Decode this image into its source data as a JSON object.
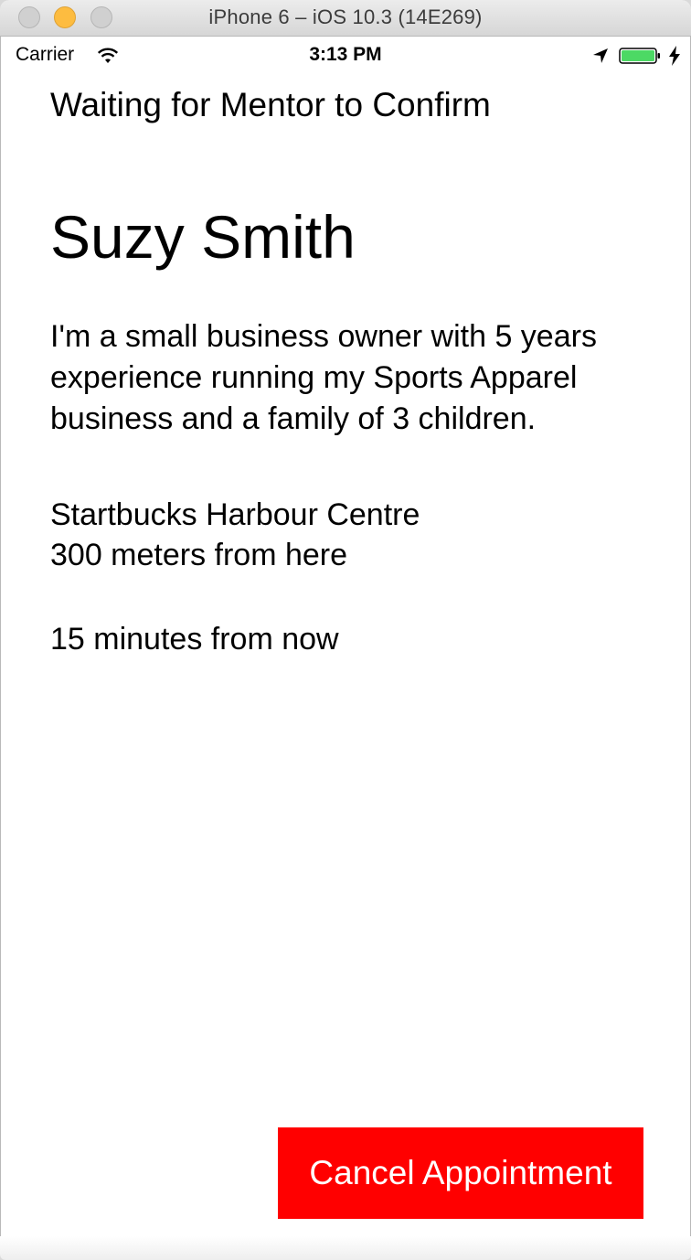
{
  "window": {
    "title": "iPhone 6 – iOS 10.3 (14E269)"
  },
  "status_bar": {
    "carrier": "Carrier",
    "time": "3:13 PM",
    "battery_color": "#4cd964",
    "icons": [
      "wifi-icon",
      "location-arrow-icon",
      "battery-icon",
      "charging-bolt-icon"
    ]
  },
  "appointment": {
    "status": "Waiting for Mentor to Confirm",
    "mentor_name": "Suzy Smith",
    "bio": "I'm a small business owner with 5 years experience running my Sports Apparel business and a family of 3 children.",
    "location_name": "Startbucks Harbour Centre",
    "location_distance": "300 meters from here",
    "meeting_time": "15 minutes from now"
  },
  "actions": {
    "cancel_label": "Cancel Appointment",
    "cancel_color": "#ff0000"
  }
}
